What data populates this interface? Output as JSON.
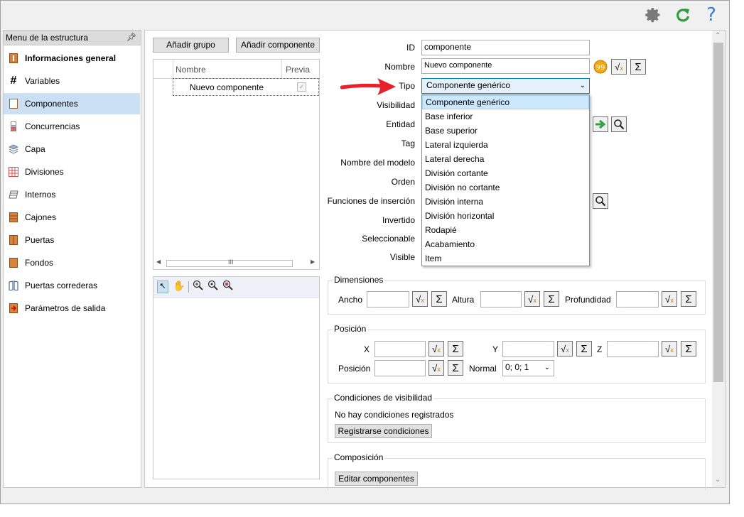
{
  "sidebar": {
    "title": "Menu de la estructura",
    "items": [
      {
        "label": "Informaciones general",
        "bold": true
      },
      {
        "label": "Variables"
      },
      {
        "label": "Componentes",
        "active": true
      },
      {
        "label": "Concurrencias"
      },
      {
        "label": "Capa"
      },
      {
        "label": "Divisiones"
      },
      {
        "label": "Internos"
      },
      {
        "label": "Cajones"
      },
      {
        "label": "Puertas"
      },
      {
        "label": "Fondos"
      },
      {
        "label": "Puertas correderas"
      },
      {
        "label": "Parámetros de salida"
      }
    ]
  },
  "toolbar": {
    "add_group": "Añadir grupo",
    "add_component": "Añadir componente"
  },
  "grid": {
    "col_name": "Nombre",
    "col_preview": "Previa",
    "row_name": "Nuevo componente"
  },
  "form": {
    "id_label": "ID",
    "id_value": "componente",
    "name_label": "Nombre",
    "name_value": "Nuevo componente",
    "tipo_label": "Tipo",
    "tipo_value": "Componente genérico",
    "visibilidad_label": "Visibilidad",
    "entidad_label": "Entidad",
    "tag_label": "Tag",
    "modelo_label": "Nombre del modelo",
    "orden_label": "Orden",
    "funciones_label": "Funciones de inserción",
    "invertido_label": "Invertido",
    "seleccionable_label": "Seleccionable",
    "visible_label": "Visible"
  },
  "dropdown": {
    "options": [
      "Componente genérico",
      "Base inferior",
      "Base superior",
      "Lateral izquierda",
      "Lateral derecha",
      "División cortante",
      "División no cortante",
      "División interna",
      "División horizontal",
      "Rodapié",
      "Acabamiento",
      "Item"
    ]
  },
  "dimensiones": {
    "title": "Dimensiones",
    "ancho": "Ancho",
    "altura": "Altura",
    "profundidad": "Profundidad"
  },
  "posicion": {
    "title": "Posición",
    "x": "X",
    "y": "Y",
    "z": "Z",
    "posicion": "Posición",
    "normal": "Normal",
    "normal_value": "0; 0; 1"
  },
  "visibilidad": {
    "title": "Condiciones de visibilidad",
    "empty": "No hay condiciones registrados",
    "register": "Registrarse condiciones"
  },
  "composicion": {
    "title": "Composición",
    "edit": "Editar componentes"
  },
  "colors": {
    "accent": "#cce0f4",
    "arrow": "#e8202a",
    "refresh": "#2e9e3e",
    "help": "#2e7fd6"
  }
}
